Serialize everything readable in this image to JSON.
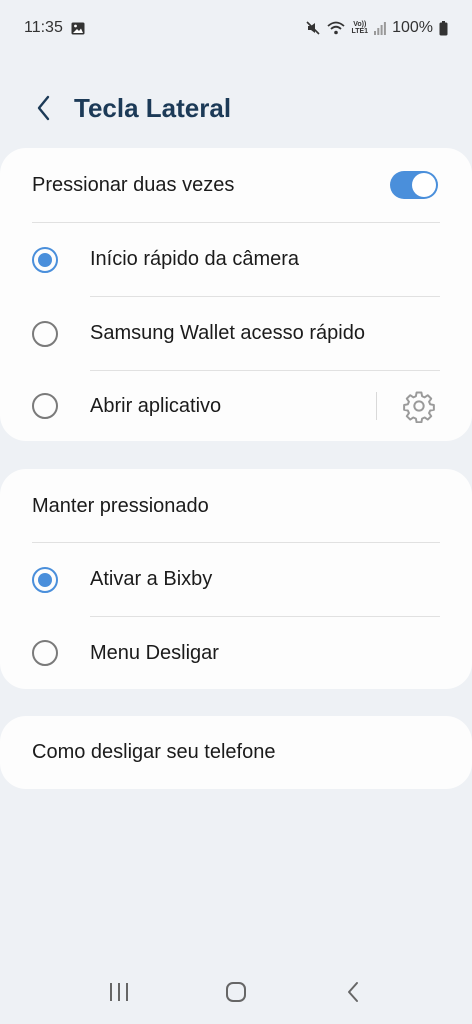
{
  "status": {
    "time": "11:35",
    "battery": "100%",
    "network_label_top": "Vo))",
    "network_label_bottom": "LTE1"
  },
  "header": {
    "title": "Tecla Lateral"
  },
  "double_press": {
    "title": "Pressionar duas vezes",
    "toggle_on": true,
    "options": [
      {
        "label": "Início rápido da câmera",
        "selected": true
      },
      {
        "label": "Samsung Wallet acesso rápido",
        "selected": false
      },
      {
        "label": "Abrir aplicativo",
        "selected": false
      }
    ]
  },
  "hold": {
    "title": "Manter pressionado",
    "options": [
      {
        "label": "Ativar a Bixby",
        "selected": true
      },
      {
        "label": "Menu Desligar",
        "selected": false
      }
    ]
  },
  "help": {
    "label": "Como desligar seu telefone"
  },
  "colors": {
    "accent": "#4a8fdb",
    "title": "#1c3a57",
    "background": "#eef1f5",
    "card": "#fdfdfd"
  }
}
